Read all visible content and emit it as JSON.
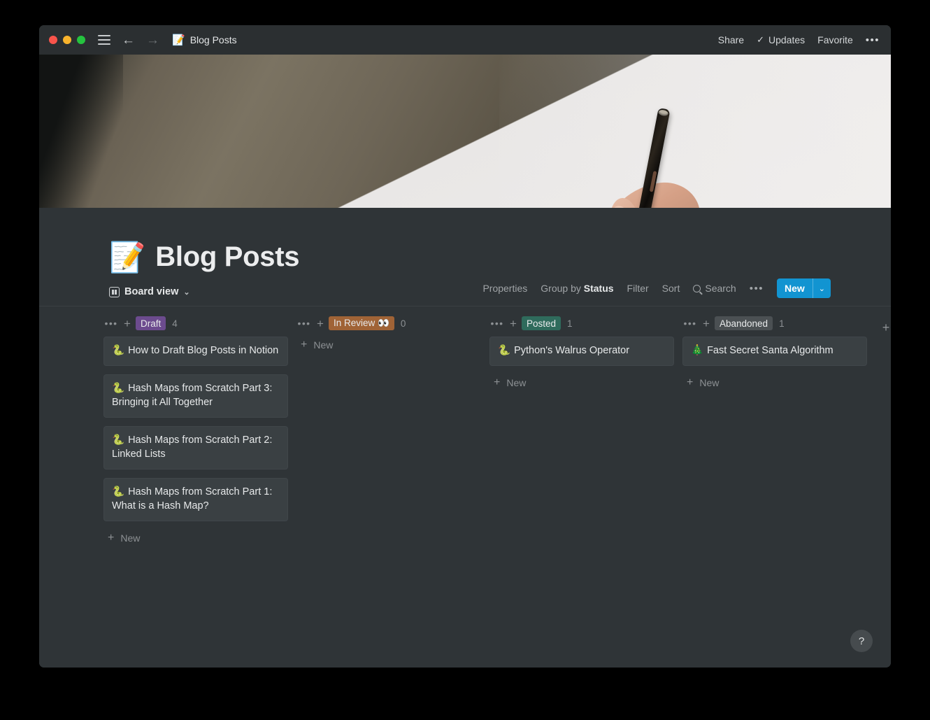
{
  "window": {
    "traffic_lights": [
      "close",
      "minimize",
      "maximize"
    ],
    "breadcrumb": {
      "emoji": "📝",
      "label": "Blog Posts"
    },
    "actions": {
      "share": "Share",
      "updates": "Updates",
      "favorite": "Favorite",
      "more": "•••"
    }
  },
  "page": {
    "emoji": "📝",
    "title": "Blog Posts",
    "view": {
      "label": "Board view",
      "chevron": "⌄"
    }
  },
  "toolbar": {
    "properties": "Properties",
    "group_by_prefix": "Group by ",
    "group_by_value": "Status",
    "filter": "Filter",
    "sort": "Sort",
    "search": "Search",
    "more": "•••",
    "new_label": "New",
    "new_chevron": "⌄",
    "accent_color": "#1294d1"
  },
  "board": {
    "columns": [
      {
        "name": "Draft",
        "badge_color": "#6c4b8e",
        "count": "4",
        "cards": [
          {
            "emoji": "🐍",
            "title": "How to Draft Blog Posts in Notion"
          },
          {
            "emoji": "🐍",
            "title": "Hash Maps from Scratch Part 3: Bringing it All Together"
          },
          {
            "emoji": "🐍",
            "title": "Hash Maps from Scratch Part 2: Linked Lists"
          },
          {
            "emoji": "🐍",
            "title": "Hash Maps from Scratch Part 1: What is a Hash Map?"
          }
        ],
        "new_label": "New"
      },
      {
        "name": "In Review 👀",
        "badge_color": "#a06336",
        "count": "0",
        "cards": [],
        "new_label": "New"
      },
      {
        "name": "Posted",
        "badge_color": "#2f6b5c",
        "count": "1",
        "cards": [
          {
            "emoji": "🐍",
            "title": "Python's Walrus Operator"
          }
        ],
        "new_label": "New"
      },
      {
        "name": "Abandoned",
        "badge_color": "#4b5053",
        "count": "1",
        "cards": [
          {
            "emoji": "🎄",
            "title": "Fast Secret Santa Algorithm"
          }
        ],
        "new_label": "New"
      }
    ],
    "column_menu": "•••",
    "column_add": "+",
    "add_column": "+"
  },
  "help_button": "?"
}
